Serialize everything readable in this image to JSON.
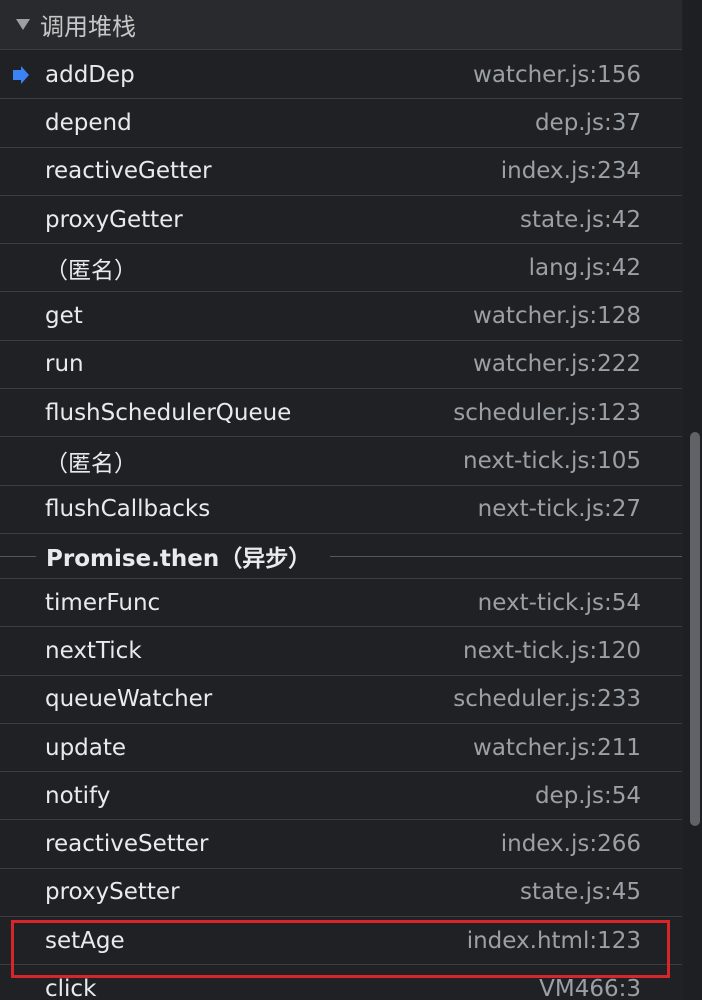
{
  "section": {
    "title": "调用堆栈"
  },
  "frames_top": [
    {
      "fn": "addDep",
      "loc": "watcher.js:156",
      "current": true
    },
    {
      "fn": "depend",
      "loc": "dep.js:37"
    },
    {
      "fn": "reactiveGetter",
      "loc": "index.js:234"
    },
    {
      "fn": "proxyGetter",
      "loc": "state.js:42"
    },
    {
      "fn": "（匿名）",
      "loc": "lang.js:42"
    },
    {
      "fn": "get",
      "loc": "watcher.js:128"
    },
    {
      "fn": "run",
      "loc": "watcher.js:222"
    },
    {
      "fn": "flushSchedulerQueue",
      "loc": "scheduler.js:123"
    },
    {
      "fn": "（匿名）",
      "loc": "next-tick.js:105"
    },
    {
      "fn": "flushCallbacks",
      "loc": "next-tick.js:27"
    }
  ],
  "async_separator": "Promise.then（异步）",
  "frames_bottom": [
    {
      "fn": "timerFunc",
      "loc": "next-tick.js:54"
    },
    {
      "fn": "nextTick",
      "loc": "next-tick.js:120"
    },
    {
      "fn": "queueWatcher",
      "loc": "scheduler.js:233"
    },
    {
      "fn": "update",
      "loc": "watcher.js:211"
    },
    {
      "fn": "notify",
      "loc": "dep.js:54"
    },
    {
      "fn": "reactiveSetter",
      "loc": "index.js:266"
    },
    {
      "fn": "proxySetter",
      "loc": "state.js:45"
    },
    {
      "fn": "setAge",
      "loc": "index.html:123",
      "highlighted": true
    },
    {
      "fn": "click",
      "loc": "VM466:3"
    }
  ],
  "colors": {
    "background": "#202124",
    "current_frame_arrow": "#3b82f6",
    "highlight_border": "#d7262b"
  }
}
